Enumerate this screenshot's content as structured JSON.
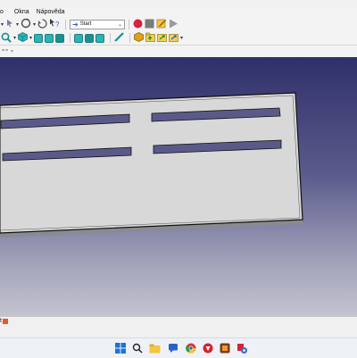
{
  "menu": {
    "items": [
      "o",
      "Okna",
      "Nápověda"
    ]
  },
  "toolbar": {
    "workbench_selector": {
      "label": "Start",
      "icon": "arrow-right-icon"
    },
    "macro_record_color": "#d6223b",
    "macro_stop_color": "#7b7b7b",
    "view_cube_color": "#2bb3b5",
    "part_color": "#d9a31a"
  },
  "viewport": {
    "background_top": "#30306a",
    "background_bottom": "#c4c4cf",
    "plate_color": "#d8d8d8",
    "slot_color": "#5a5a8a"
  },
  "document_tabs": [
    {
      "label": "t",
      "close_icon": "close-icon"
    }
  ],
  "taskbar": {
    "icons": [
      "windows-start-icon",
      "search-icon",
      "file-explorer-icon",
      "chat-icon",
      "chrome-icon",
      "app-red-icon",
      "app-brown-icon",
      "freecad-icon"
    ]
  }
}
